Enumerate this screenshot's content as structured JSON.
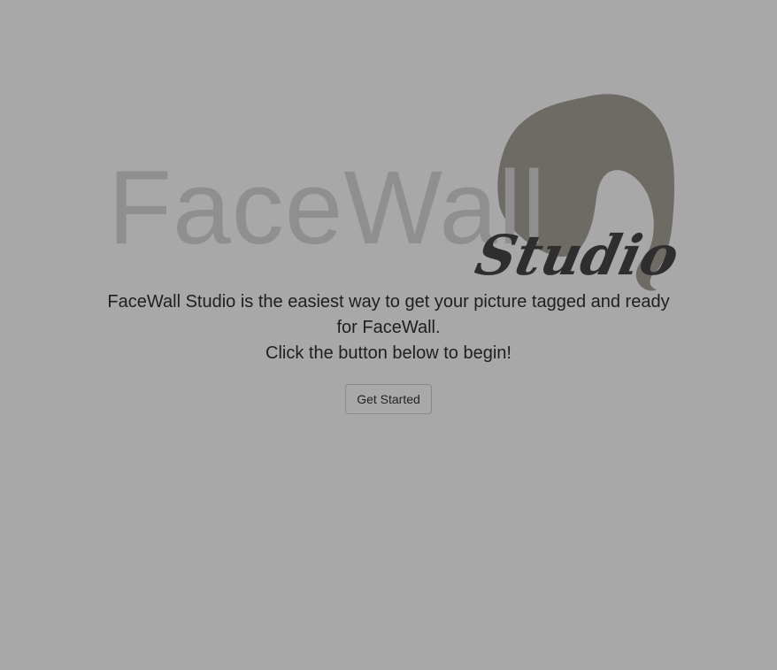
{
  "logo": {
    "wordmark": "FaceWall",
    "script_word": "Studio",
    "hair_icon": "woman-hair-silhouette-icon",
    "colors": {
      "wordmark": "#8f8f8f",
      "hair": "#6e6b64",
      "script": "#2e2e2e"
    }
  },
  "intro": {
    "line1": "FaceWall Studio is the easiest way to get your picture tagged and ready for FaceWall.",
    "line2": "Click the button below to begin!"
  },
  "actions": {
    "get_started_label": "Get Started"
  },
  "theme": {
    "background": "#a8a8a8",
    "text": "#1f1f1f"
  }
}
